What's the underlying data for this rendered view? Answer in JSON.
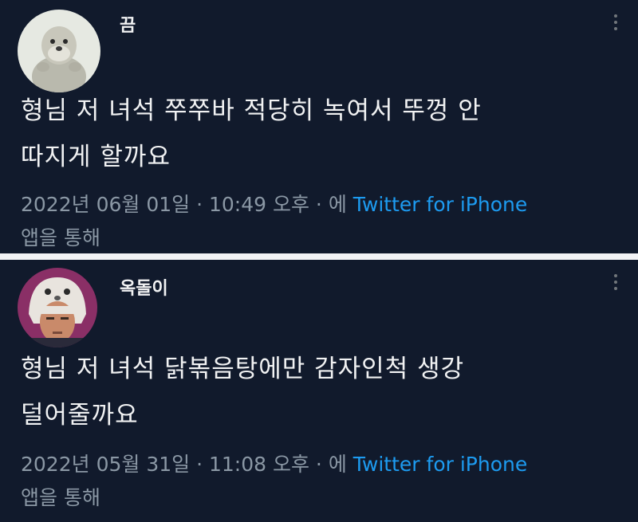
{
  "tweets": [
    {
      "username": "끔",
      "text_line1": "형님 저 녀석 쭈쭈바 적당히 녹여서 뚜껑 안",
      "text_line2": "따지게 할까요",
      "date": "2022년 06월 01일",
      "sep1": " · ",
      "time": "10:49 오후",
      "sep2": " · ",
      "via_prefix": "에 ",
      "source": "Twitter for iPhone",
      "via_suffix": "앱을 통해",
      "avatar_icon": "otter-avatar-icon"
    },
    {
      "username": "옥돌이",
      "text_line1": "형님 저 녀석 닭볶음탕에만 감자인척 생강",
      "text_line2": "덜어줄까요",
      "date": "2022년 05월 31일",
      "sep1": " · ",
      "time": "11:08 오후",
      "sep2": " · ",
      "via_prefix": "에 ",
      "source": "Twitter for iPhone",
      "via_suffix": "앱을 통해",
      "avatar_icon": "man-in-animal-hat-avatar-icon"
    }
  ],
  "colors": {
    "background": "#111a2c",
    "divider": "#f2f3f5",
    "meta_text": "#8b98a5",
    "link": "#1d9bf0"
  }
}
